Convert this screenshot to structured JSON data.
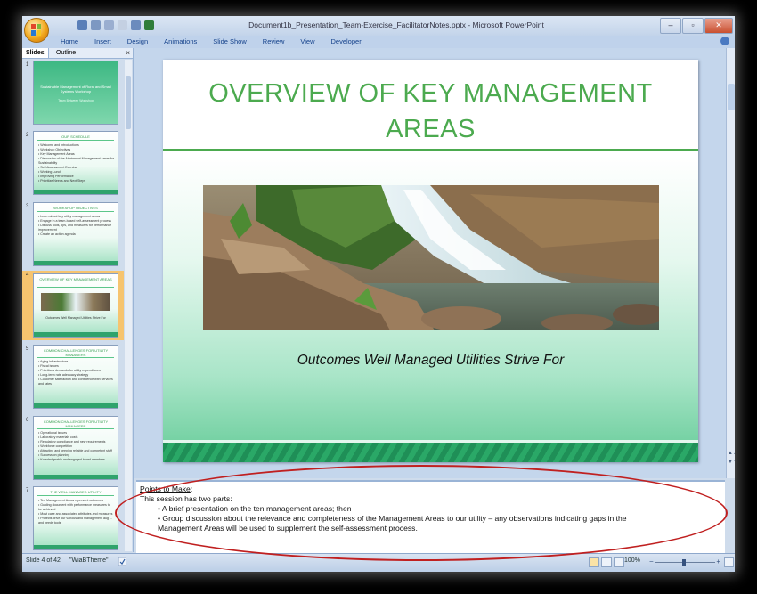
{
  "window": {
    "title": "Document1b_Presentation_Team-Exercise_FacilitatorNotes.pptx - Microsoft PowerPoint"
  },
  "ribbon": {
    "tabs": [
      "Home",
      "Insert",
      "Design",
      "Animations",
      "Slide Show",
      "Review",
      "View",
      "Developer"
    ]
  },
  "pane": {
    "tab_slides": "Slides",
    "tab_outline": "Outline",
    "close": "×"
  },
  "thumbnails": [
    {
      "num": "1",
      "title": "Sustainable Management of Rural and Small Systems Workshop",
      "sub": "Team Between Workshop",
      "kind": "title"
    },
    {
      "num": "2",
      "title": "OUR SCHEDULE",
      "bullets": "• Welcome and Introductions\n• Workshop Objectives\n• Key Management Areas\n• Discussion of the Attainment Management Areas for Sustainability\n• Self-Assessment Exercise\n• Working Lunch\n• Improving Performance\n• Prioritize Needs and Next Steps",
      "kind": "text"
    },
    {
      "num": "3",
      "title": "WORKSHOP OBJECTIVES",
      "bullets": "• Learn about key utility management areas\n• Engage in a team-based self-assessment process\n• Discuss tools, tips, and measures for performance improvement\n• Create an action agenda",
      "kind": "text"
    },
    {
      "num": "4",
      "title": "OVERVIEW OF KEY MANAGEMENT AREAS",
      "caption": "Outcomes Well Managed Utilities Strive For",
      "kind": "picture"
    },
    {
      "num": "5",
      "title": "COMMON CHALLENGES FOR UTILITY MANAGERS",
      "bullets": "• Aging infrastructure\n• Fiscal issues\n  • Prioritizes demands for utility expenditures\n  • Long-term rate adequacy strategy\n• Customer satisfaction and confidence with services and rates",
      "kind": "text"
    },
    {
      "num": "6",
      "title": "COMMON CHALLENGES FOR UTILITY MANAGERS",
      "bullets": "• Operational issues\n  • Laboratory materials costs\n  • Regulatory compliance and new requirements\n• Workforce competition\n  • Attracting and keeping reliable and competent staff\n  • Succession planning\n• Knowledgeable and engaged board members",
      "kind": "text"
    },
    {
      "num": "7",
      "title": "THE WELL MANAGED UTILITY",
      "bullets": "• Ten Management Areas represent outcomes\n• Guiding document with performance measures to be achieved\n• Most case and associated attributes and measures\n• Protects drive our various and management aug ... and needs tools",
      "kind": "text"
    }
  ],
  "slide": {
    "title": "OVERVIEW OF KEY MANAGEMENT AREAS",
    "subtitle": "Outcomes Well Managed Utilities Strive For"
  },
  "notes": {
    "heading": "Points to Make",
    "heading_colon": ":",
    "line1": "This session has two parts:",
    "bullet1": "• A brief presentation on the ten management areas; then",
    "bullet2": "• Group discussion about the relevance and completeness of the Management Areas to our utility – any observations indicating gaps in the",
    "bullet2_cont": "Management Areas will be used to supplement the self-assessment process."
  },
  "status": {
    "slide_of": "Slide 4 of 42",
    "theme": "\"WiaBTheme\"",
    "zoom": "100%"
  },
  "colors": {
    "title_green": "#4caa4f",
    "annotation_red": "#c02020"
  }
}
